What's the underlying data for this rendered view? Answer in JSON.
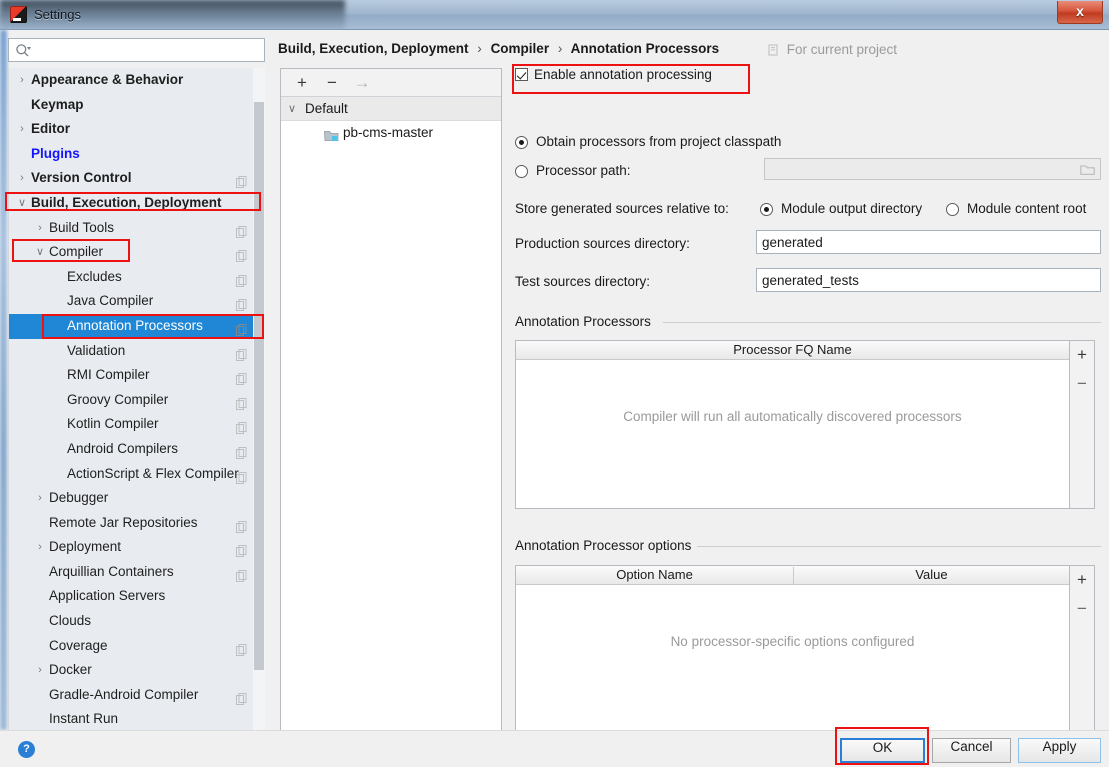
{
  "window": {
    "title": "Settings",
    "app_icon": "intellij-idea-icon",
    "close_label": "x"
  },
  "search": {
    "value": "",
    "placeholder": "",
    "icon": "search-icon"
  },
  "sidebar": {
    "items": [
      {
        "label": "Appearance & Behavior",
        "indent": 0,
        "twisty": "›",
        "bold": true,
        "copy": false,
        "selected": false,
        "plugin": false
      },
      {
        "label": "Keymap",
        "indent": 0,
        "twisty": "",
        "bold": true,
        "copy": false,
        "selected": false,
        "plugin": false
      },
      {
        "label": "Editor",
        "indent": 0,
        "twisty": "›",
        "bold": true,
        "copy": false,
        "selected": false,
        "plugin": false
      },
      {
        "label": "Plugins",
        "indent": 0,
        "twisty": "",
        "bold": true,
        "copy": false,
        "selected": false,
        "plugin": true
      },
      {
        "label": "Version Control",
        "indent": 0,
        "twisty": "›",
        "bold": true,
        "copy": true,
        "selected": false,
        "plugin": false
      },
      {
        "label": "Build, Execution, Deployment",
        "indent": 0,
        "twisty": "∨",
        "bold": true,
        "copy": false,
        "selected": false,
        "plugin": false
      },
      {
        "label": "Build Tools",
        "indent": 1,
        "twisty": "›",
        "bold": false,
        "copy": true,
        "selected": false,
        "plugin": false
      },
      {
        "label": "Compiler",
        "indent": 1,
        "twisty": "∨",
        "bold": false,
        "copy": true,
        "selected": false,
        "plugin": false
      },
      {
        "label": "Excludes",
        "indent": 2,
        "twisty": "",
        "bold": false,
        "copy": true,
        "selected": false,
        "plugin": false
      },
      {
        "label": "Java Compiler",
        "indent": 2,
        "twisty": "",
        "bold": false,
        "copy": true,
        "selected": false,
        "plugin": false
      },
      {
        "label": "Annotation Processors",
        "indent": 2,
        "twisty": "",
        "bold": false,
        "copy": true,
        "selected": true,
        "plugin": false
      },
      {
        "label": "Validation",
        "indent": 2,
        "twisty": "",
        "bold": false,
        "copy": true,
        "selected": false,
        "plugin": false
      },
      {
        "label": "RMI Compiler",
        "indent": 2,
        "twisty": "",
        "bold": false,
        "copy": true,
        "selected": false,
        "plugin": false
      },
      {
        "label": "Groovy Compiler",
        "indent": 2,
        "twisty": "",
        "bold": false,
        "copy": true,
        "selected": false,
        "plugin": false
      },
      {
        "label": "Kotlin Compiler",
        "indent": 2,
        "twisty": "",
        "bold": false,
        "copy": true,
        "selected": false,
        "plugin": false
      },
      {
        "label": "Android Compilers",
        "indent": 2,
        "twisty": "",
        "bold": false,
        "copy": true,
        "selected": false,
        "plugin": false
      },
      {
        "label": "ActionScript & Flex Compiler",
        "indent": 2,
        "twisty": "",
        "bold": false,
        "copy": true,
        "selected": false,
        "plugin": false
      },
      {
        "label": "Debugger",
        "indent": 1,
        "twisty": "›",
        "bold": false,
        "copy": false,
        "selected": false,
        "plugin": false
      },
      {
        "label": "Remote Jar Repositories",
        "indent": 1,
        "twisty": "",
        "bold": false,
        "copy": true,
        "selected": false,
        "plugin": false
      },
      {
        "label": "Deployment",
        "indent": 1,
        "twisty": "›",
        "bold": false,
        "copy": true,
        "selected": false,
        "plugin": false
      },
      {
        "label": "Arquillian Containers",
        "indent": 1,
        "twisty": "",
        "bold": false,
        "copy": true,
        "selected": false,
        "plugin": false
      },
      {
        "label": "Application Servers",
        "indent": 1,
        "twisty": "",
        "bold": false,
        "copy": false,
        "selected": false,
        "plugin": false
      },
      {
        "label": "Clouds",
        "indent": 1,
        "twisty": "",
        "bold": false,
        "copy": false,
        "selected": false,
        "plugin": false
      },
      {
        "label": "Coverage",
        "indent": 1,
        "twisty": "",
        "bold": false,
        "copy": true,
        "selected": false,
        "plugin": false
      },
      {
        "label": "Docker",
        "indent": 1,
        "twisty": "›",
        "bold": false,
        "copy": false,
        "selected": false,
        "plugin": false
      },
      {
        "label": "Gradle-Android Compiler",
        "indent": 1,
        "twisty": "",
        "bold": false,
        "copy": true,
        "selected": false,
        "plugin": false
      },
      {
        "label": "Instant Run",
        "indent": 1,
        "twisty": "",
        "bold": false,
        "copy": false,
        "selected": false,
        "plugin": false
      }
    ]
  },
  "breadcrumb": {
    "part1": "Build, Execution, Deployment",
    "part2": "Compiler",
    "part3": "Annotation Processors",
    "separator": "›"
  },
  "for_current_project": {
    "label": "For current project",
    "icon": "project-scope-icon"
  },
  "profiles": {
    "toolbar": {
      "add": "+",
      "remove": "−",
      "move": "→"
    },
    "root_label": "Default",
    "root_twisty": "∨",
    "module_label": "pb-cms-master",
    "module_icon": "module-folder-icon"
  },
  "form": {
    "enable_annotation_processing": {
      "label": "Enable annotation processing",
      "checked": true
    },
    "processor_source": {
      "obtain_from_classpath": {
        "label": "Obtain processors from project classpath",
        "selected": true
      },
      "processor_path": {
        "label": "Processor path:",
        "selected": false,
        "value": "",
        "browse_icon": "folder-browse-icon"
      }
    },
    "store_relative_label": "Store generated sources relative to:",
    "store_relative_options": [
      {
        "label": "Module output directory",
        "selected": true
      },
      {
        "label": "Module content root",
        "selected": false
      }
    ],
    "production_sources": {
      "label": "Production sources directory:",
      "value": "generated"
    },
    "test_sources": {
      "label": "Test sources directory:",
      "value": "generated_tests"
    }
  },
  "processors_section": {
    "caption": "Annotation Processors",
    "columns": [
      "Processor FQ Name"
    ],
    "rows": [],
    "empty_text": "Compiler will run all automatically discovered processors",
    "add_button": "+",
    "remove_button": "−"
  },
  "options_section": {
    "caption": "Annotation Processor options",
    "columns": [
      "Option Name",
      "Value"
    ],
    "rows": [],
    "empty_text": "No processor-specific options configured",
    "add_button": "+",
    "remove_button": "−"
  },
  "footer": {
    "help_label": "?",
    "ok_label": "OK",
    "cancel_label": "Cancel",
    "apply_label": "Apply"
  },
  "colors": {
    "selection_blue": "#1f87d6",
    "annotation_red": "#ee1111",
    "plugin_link_blue": "#1414ff",
    "accent_button_blue": "#2a7fd4"
  }
}
